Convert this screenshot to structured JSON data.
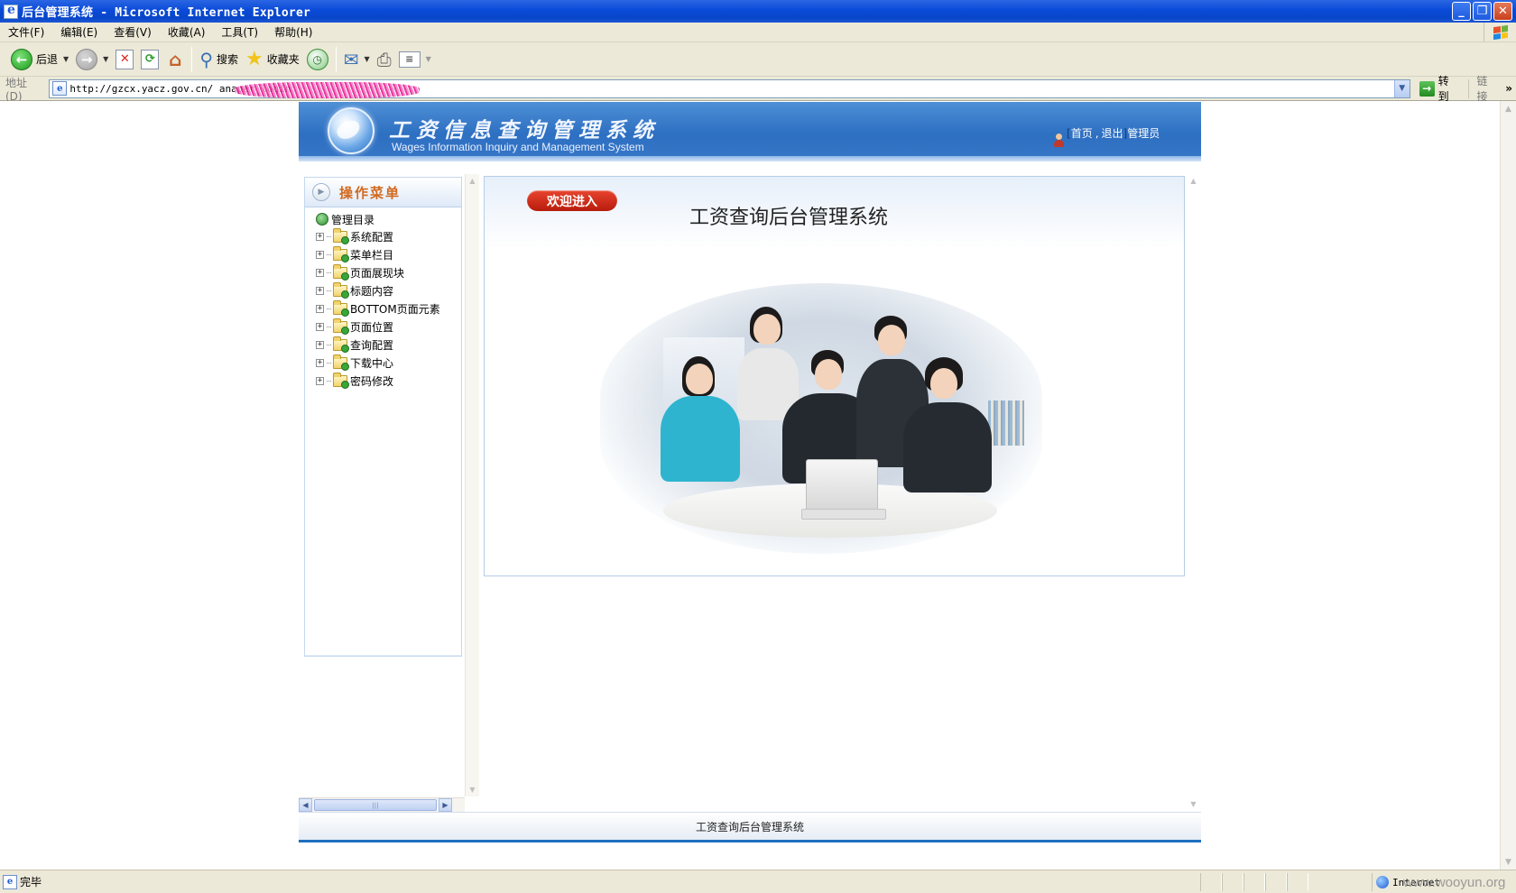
{
  "window": {
    "title": "后台管理系统 - Microsoft Internet Explorer"
  },
  "menubar": {
    "items": [
      "文件(F)",
      "编辑(E)",
      "查看(V)",
      "收藏(A)",
      "工具(T)",
      "帮助(H)"
    ]
  },
  "toolbar": {
    "back_label": "后退",
    "search_label": "搜索",
    "favorites_label": "收藏夹"
  },
  "addressbar": {
    "label": "地址(D)",
    "url": "http://gzcx.yacz.gov.cn/                                     anager_login",
    "go_label": "转到",
    "links_label": "链接"
  },
  "site": {
    "title_cn": "工资信息查询管理系统",
    "title_en": "Wages Information Inquiry and Management System",
    "header_links": {
      "home": "首页",
      "logout": "退出",
      "role": "管理员"
    }
  },
  "left_menu": {
    "heading": "操作菜单",
    "root": "管理目录",
    "items": [
      "系统配置",
      "菜单栏目",
      "页面展现块",
      "标题内容",
      "BOTTOM页面元素",
      "页面位置",
      "查询配置",
      "下载中心",
      "密码修改"
    ]
  },
  "main": {
    "welcome_badge": "欢迎进入",
    "welcome_title": "工资查询后台管理系统"
  },
  "footer": {
    "text": "工资查询后台管理系统"
  },
  "statusbar": {
    "text": "完毕",
    "zone": "Internet"
  },
  "watermark": "www.wooyun.org",
  "colors": {
    "titlebar": "#0a4ad8",
    "header_blue": "#2d6fc1",
    "menu_heading": "#d2691e",
    "welcome_badge": "#c8200f",
    "footer_line": "#1f6fbf"
  }
}
